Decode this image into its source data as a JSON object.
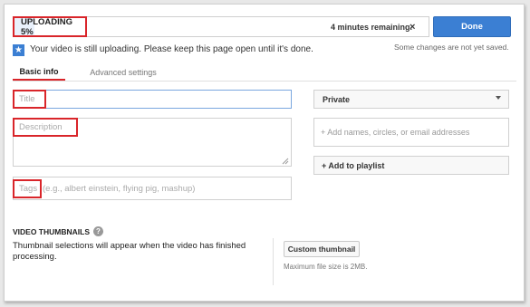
{
  "upload": {
    "status_label": "UPLOADING 5%",
    "progress_percent": 5,
    "remaining_text": "4 minutes remaining.",
    "close_glyph": "×",
    "done_label": "Done",
    "unsaved_note": "Some changes are not yet saved.",
    "info_message": "Your video is still uploading. Please keep this page open until it's done.",
    "info_icon": "star-icon"
  },
  "tabs": [
    {
      "label": "Basic info",
      "active": true
    },
    {
      "label": "Advanced settings",
      "active": false
    }
  ],
  "form": {
    "title_placeholder": "Title",
    "description_placeholder": "Description",
    "tags_label": "Tags",
    "tags_placeholder": "(e.g., albert einstein, flying pig, mashup)"
  },
  "sidebar": {
    "privacy_value": "Private",
    "share_placeholder": "+ Add names, circles, or email addresses",
    "playlist_label": "+ Add to playlist"
  },
  "thumbnails": {
    "heading": "VIDEO THUMBNAILS",
    "help_glyph": "?",
    "message": "Thumbnail selections will appear when the video has finished processing.",
    "custom_button": "Custom thumbnail",
    "max_size_text": "Maximum file size is 2MB."
  },
  "colors": {
    "accent_blue": "#3b7fd3",
    "highlight_red": "#d9252a"
  }
}
